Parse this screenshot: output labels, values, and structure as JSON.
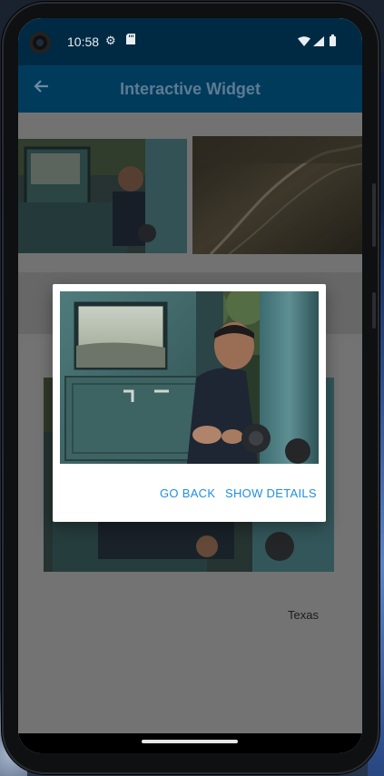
{
  "status_bar": {
    "time": "10:58",
    "icons": [
      "settings-gear-icon",
      "sd-card-icon",
      "wifi-icon",
      "signal-icon",
      "battery-icon"
    ]
  },
  "app_bar": {
    "title": "Interactive Widget",
    "back_icon": "back-arrow-icon"
  },
  "detail_sheet": {
    "location": "Texas"
  },
  "dialog": {
    "buttons": {
      "go_back": "GO BACK",
      "show_details": "SHOW DETAILS"
    }
  },
  "colors": {
    "status_bar_bg": "#002a44",
    "app_bar_bg": "#013b5b",
    "accent": "#1d8fe5",
    "dialog_bg": "#ffffff"
  }
}
